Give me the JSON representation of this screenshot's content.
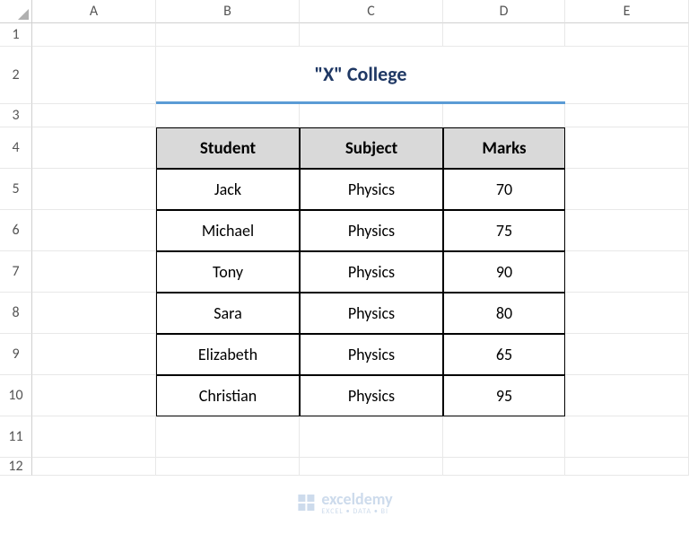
{
  "columns": [
    "A",
    "B",
    "C",
    "D",
    "E"
  ],
  "rows": [
    "1",
    "2",
    "3",
    "4",
    "5",
    "6",
    "7",
    "8",
    "9",
    "10",
    "11",
    "12"
  ],
  "title": "\"X\" College",
  "headers": {
    "student": "Student",
    "subject": "Subject",
    "marks": "Marks"
  },
  "data": [
    {
      "student": "Jack",
      "subject": "Physics",
      "marks": "70"
    },
    {
      "student": "Michael",
      "subject": "Physics",
      "marks": "75"
    },
    {
      "student": "Tony",
      "subject": "Physics",
      "marks": "90"
    },
    {
      "student": "Sara",
      "subject": "Physics",
      "marks": "80"
    },
    {
      "student": "Elizabeth",
      "subject": "Physics",
      "marks": "65"
    },
    {
      "student": "Christian",
      "subject": "Physics",
      "marks": "95"
    }
  ],
  "watermark": {
    "text": "exceldemy",
    "sub": "EXCEL • DATA • BI"
  },
  "chart_data": {
    "type": "table",
    "title": "\"X\" College",
    "columns": [
      "Student",
      "Subject",
      "Marks"
    ],
    "rows": [
      [
        "Jack",
        "Physics",
        70
      ],
      [
        "Michael",
        "Physics",
        75
      ],
      [
        "Tony",
        "Physics",
        90
      ],
      [
        "Sara",
        "Physics",
        80
      ],
      [
        "Elizabeth",
        "Physics",
        65
      ],
      [
        "Christian",
        "Physics",
        95
      ]
    ]
  }
}
